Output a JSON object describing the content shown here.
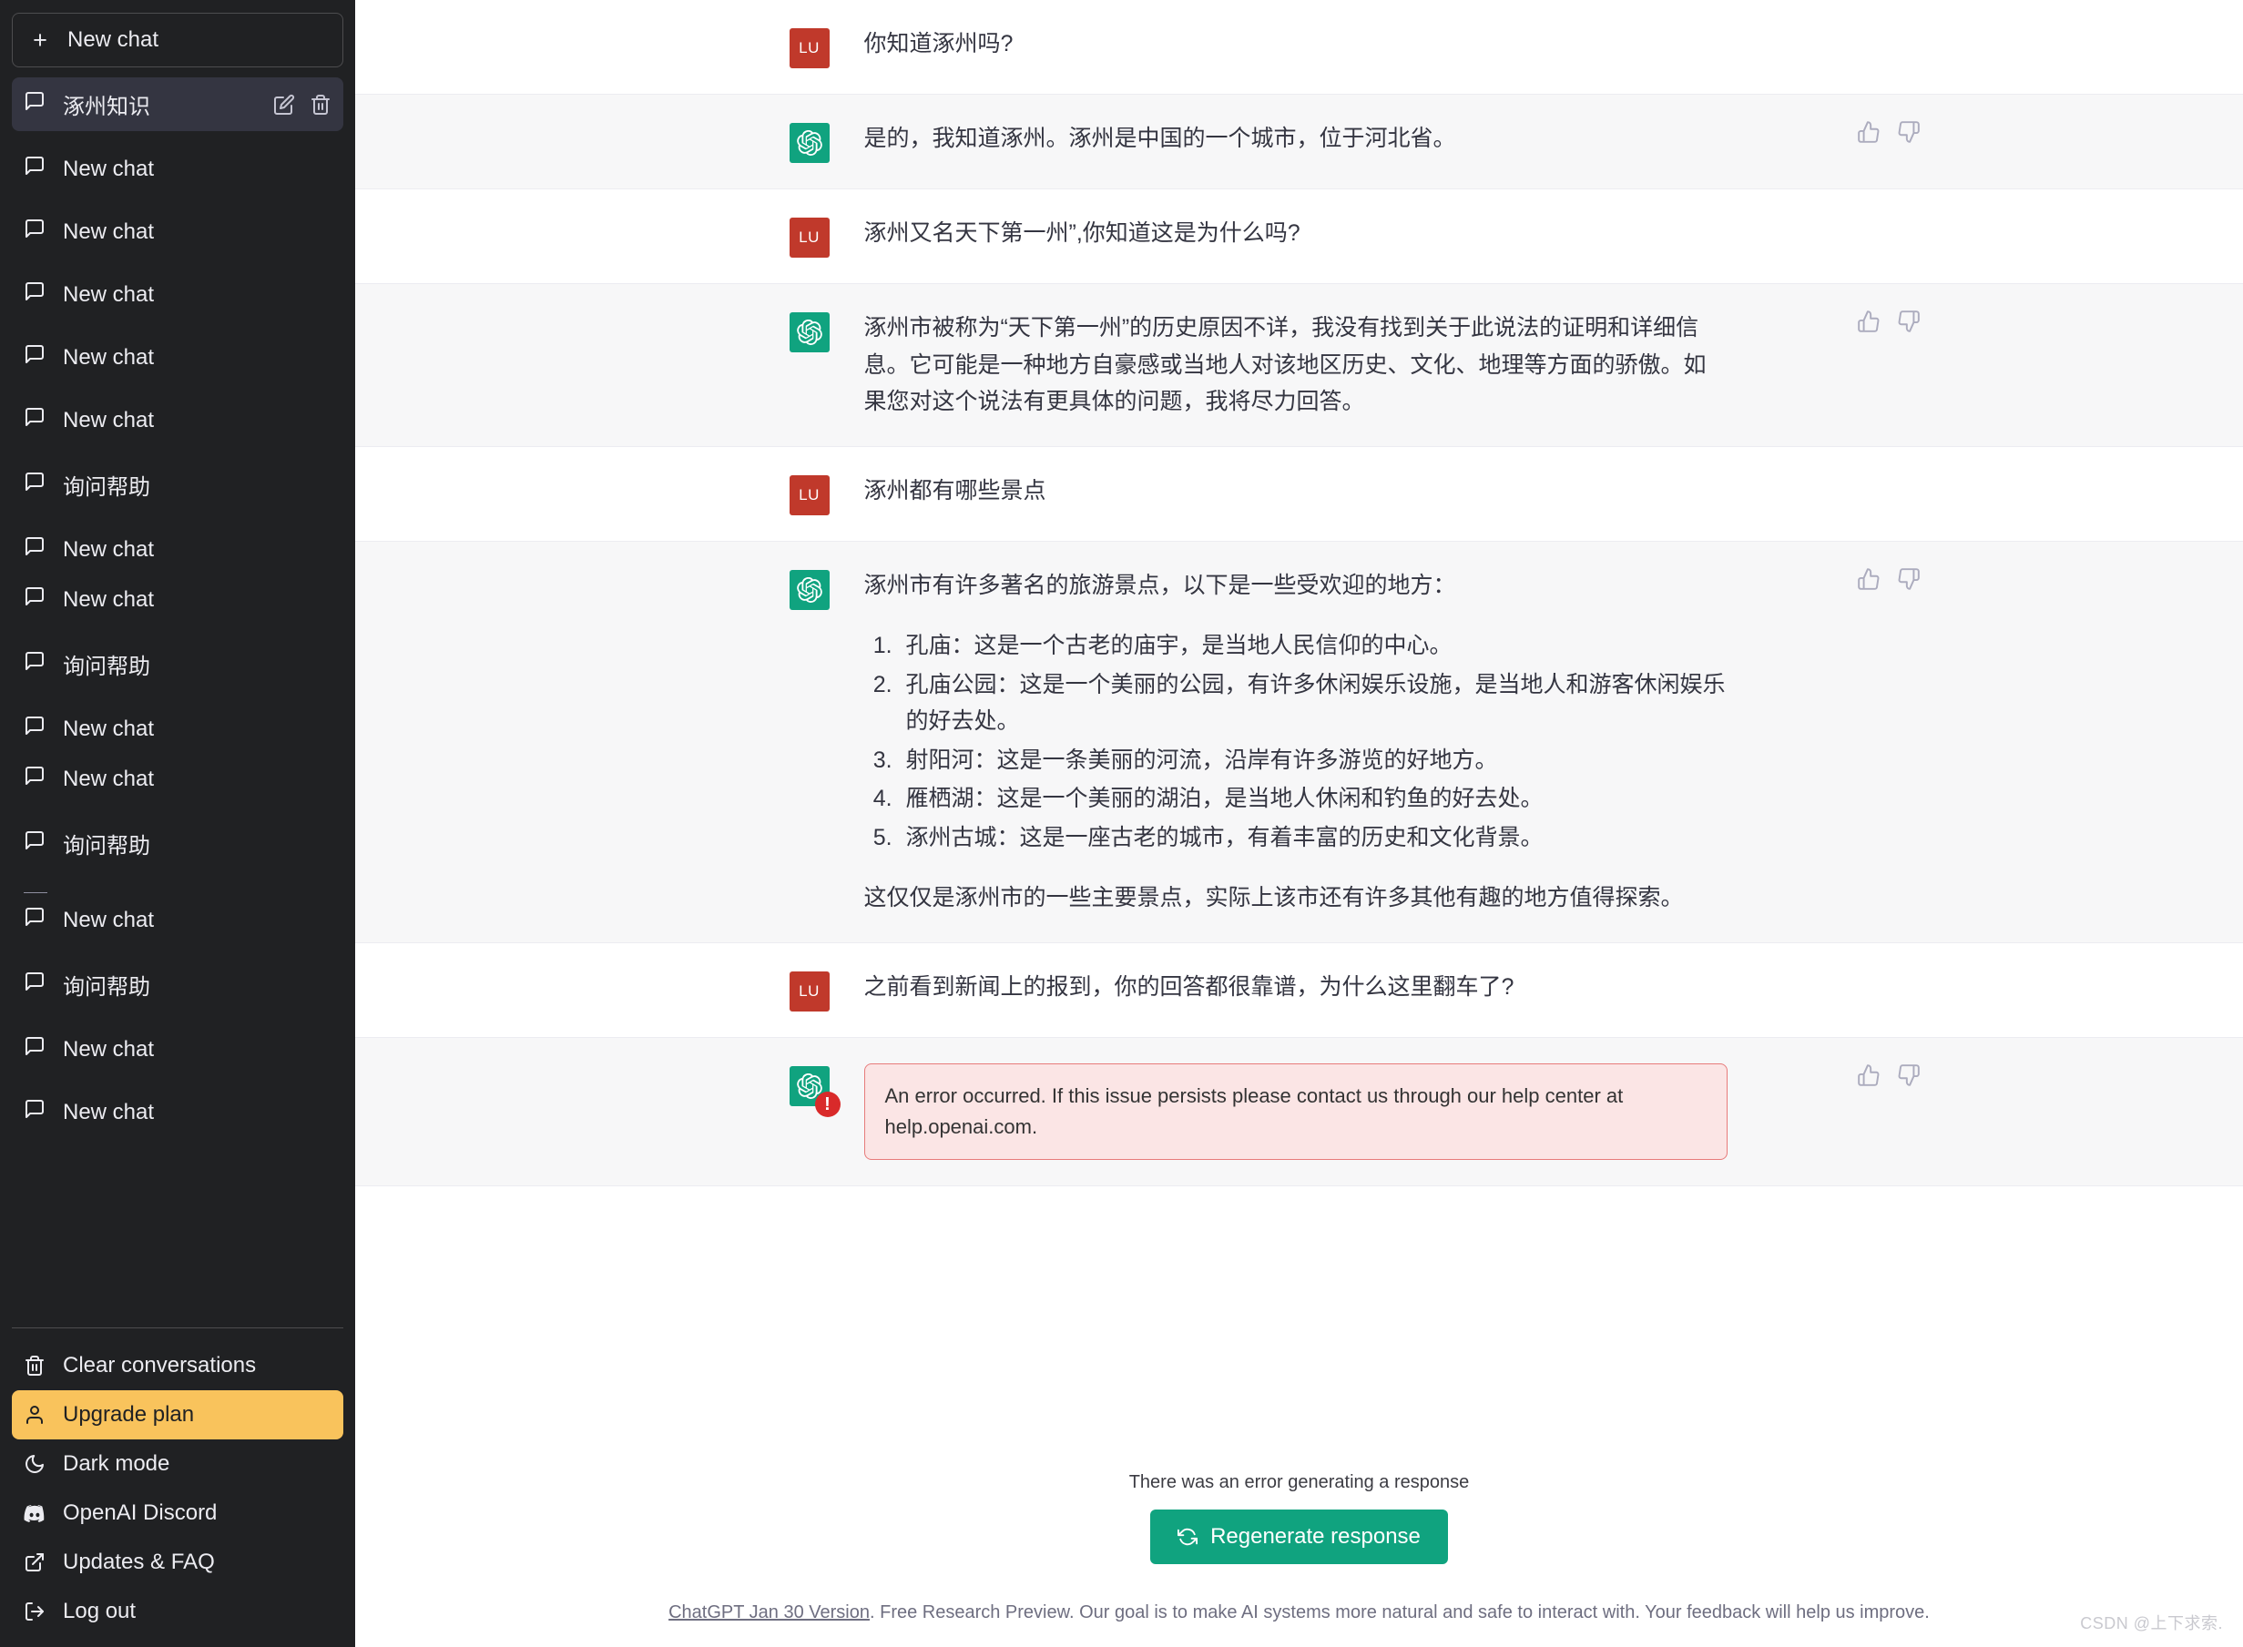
{
  "sidebar": {
    "new_chat_label": "New chat",
    "conversations": [
      {
        "label": "涿州知识",
        "active": true,
        "gap_before": 0
      },
      {
        "label": "New chat",
        "active": false,
        "gap_before": 1
      },
      {
        "label": "New chat",
        "active": false,
        "gap_before": 1
      },
      {
        "label": "New chat",
        "active": false,
        "gap_before": 1
      },
      {
        "label": "New chat",
        "active": false,
        "gap_before": 1
      },
      {
        "label": "New chat",
        "active": false,
        "gap_before": 1
      },
      {
        "label": "询问帮助",
        "active": false,
        "gap_before": 1
      },
      {
        "label": "New chat",
        "active": false,
        "gap_before": 1
      },
      {
        "label": "New chat",
        "active": false,
        "gap_before": 0
      },
      {
        "label": "询问帮助",
        "active": false,
        "gap_before": 1
      },
      {
        "label": "New chat",
        "active": false,
        "gap_before": 1
      },
      {
        "label": "New chat",
        "active": false,
        "gap_before": 0
      },
      {
        "label": "询问帮助",
        "active": false,
        "gap_before": 1
      },
      {
        "label": "New chat",
        "active": false,
        "gap_before": 2
      },
      {
        "label": "询问帮助",
        "active": false,
        "gap_before": 1
      },
      {
        "label": "New chat",
        "active": false,
        "gap_before": 1
      },
      {
        "label": "New chat",
        "active": false,
        "gap_before": 1
      }
    ],
    "menu": [
      {
        "label": "Clear conversations",
        "icon": "trash-icon",
        "highlight": false
      },
      {
        "label": "Upgrade plan",
        "icon": "user-icon",
        "highlight": true
      },
      {
        "label": "Dark mode",
        "icon": "moon-icon",
        "highlight": false
      },
      {
        "label": "OpenAI Discord",
        "icon": "discord-icon",
        "highlight": false
      },
      {
        "label": "Updates & FAQ",
        "icon": "external-link-icon",
        "highlight": false
      },
      {
        "label": "Log out",
        "icon": "logout-icon",
        "highlight": false
      }
    ]
  },
  "avatars": {
    "user_initials": "LU",
    "user_color": "#c0392b",
    "bot_color": "#10a37f",
    "error_badge": "!"
  },
  "messages": [
    {
      "role": "user",
      "text": "你知道涿州吗?"
    },
    {
      "role": "bot",
      "text": "是的，我知道涿州。涿州是中国的一个城市，位于河北省。"
    },
    {
      "role": "user",
      "text": "涿州又名天下第一州”,你知道这是为什么吗?"
    },
    {
      "role": "bot",
      "text": "涿州市被称为“天下第一州”的历史原因不详，我没有找到关于此说法的证明和详细信息。它可能是一种地方自豪感或当地人对该地区历史、文化、地理等方面的骄傲。如果您对这个说法有更具体的问题，我将尽力回答。"
    },
    {
      "role": "user",
      "text": "涿州都有哪些景点"
    },
    {
      "role": "bot",
      "intro": "涿州市有许多著名的旅游景点，以下是一些受欢迎的地方：",
      "list": [
        "孔庙：这是一个古老的庙宇，是当地人民信仰的中心。",
        "孔庙公园：这是一个美丽的公园，有许多休闲娱乐设施，是当地人和游客休闲娱乐的好去处。",
        "射阳河：这是一条美丽的河流，沿岸有许多游览的好地方。",
        "雁栖湖：这是一个美丽的湖泊，是当地人休闲和钓鱼的好去处。",
        "涿州古城：这是一座古老的城市，有着丰富的历史和文化背景。"
      ],
      "outro": "这仅仅是涿州市的一些主要景点，实际上该市还有许多其他有趣的地方值得探索。"
    },
    {
      "role": "user",
      "text": "之前看到新闻上的报到，你的回答都很靠谱，为什么这里翻车了?"
    },
    {
      "role": "bot",
      "error": "An error occurred. If this issue persists please contact us through our help center at help.openai.com."
    }
  ],
  "footer": {
    "error_note": "There was an error generating a response",
    "regenerate_label": "Regenerate response",
    "version_link": "ChatGPT Jan 30 Version",
    "disclaimer": ". Free Research Preview. Our goal is to make AI systems more natural and safe to interact with. Your feedback will help us improve.",
    "watermark": "CSDN @上下求索."
  }
}
